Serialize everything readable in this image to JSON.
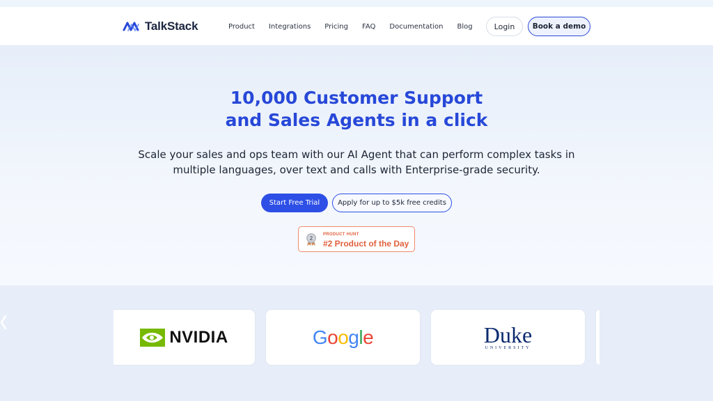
{
  "header": {
    "logo_text": "TalkStack",
    "nav": [
      "Product",
      "Integrations",
      "Pricing",
      "FAQ",
      "Documentation",
      "Blog"
    ],
    "login_label": "Login",
    "demo_label": "Book a demo"
  },
  "hero": {
    "title_line1": "10,000 Customer Support",
    "title_line2": "and Sales Agents in a click",
    "subtitle_line1": "Scale your sales and ops team with our AI Agent that can perform complex tasks in",
    "subtitle_line2": "multiple languages, over text and calls with Enterprise-grade security.",
    "primary_cta": "Start Free Trial",
    "secondary_cta": "Apply for up to $5k free credits"
  },
  "product_hunt": {
    "small_label": "PRODUCT HUNT",
    "rank_label": "#2 Product of the Day",
    "medal_number": "2"
  },
  "logos": {
    "nvidia": "NVIDIA",
    "google": [
      "G",
      "o",
      "o",
      "g",
      "l",
      "e"
    ],
    "duke": "Duke",
    "duke_sub": "UNIVERSITY"
  },
  "colors": {
    "brand_blue": "#2d4fe6",
    "title_blue": "#2748d8",
    "product_hunt_orange": "#e0603d",
    "nvidia_green": "#76b900"
  }
}
